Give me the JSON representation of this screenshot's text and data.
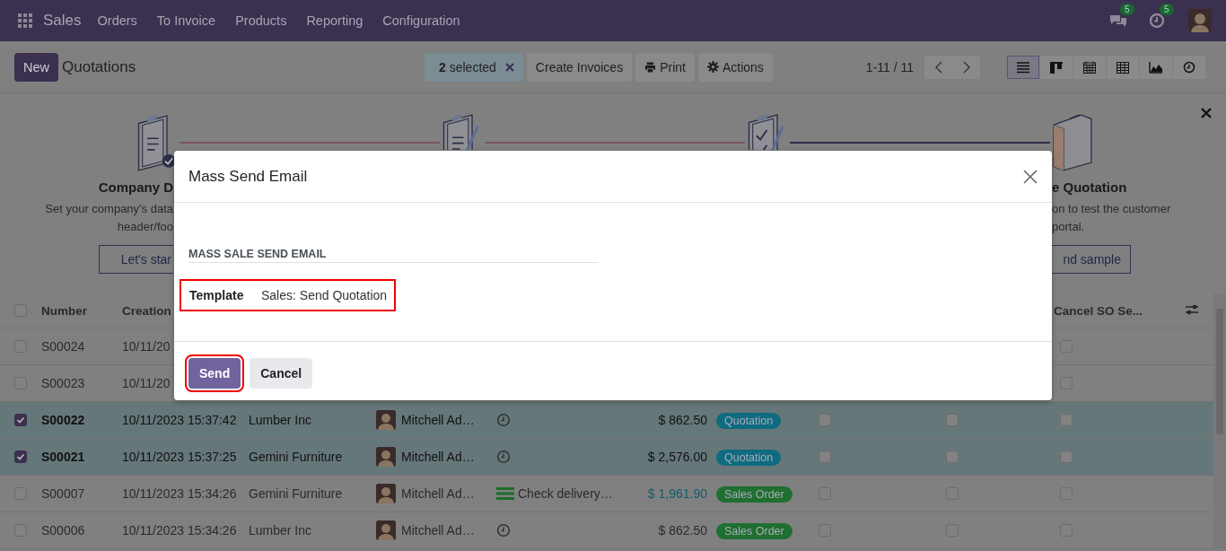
{
  "navbar": {
    "app": "Sales",
    "menu": [
      "Orders",
      "To Invoice",
      "Products",
      "Reporting",
      "Configuration"
    ],
    "messages_count": "5",
    "activities_count": "5"
  },
  "control_panel": {
    "new_button": "New",
    "title": "Quotations",
    "selection": "**2** selected",
    "actions": [
      {
        "kind": "plain",
        "label": "Create Invoices"
      },
      {
        "kind": "print",
        "label": "Print"
      },
      {
        "kind": "gear",
        "label": "Actions"
      }
    ],
    "pager": "1-11 / 11",
    "views": [
      {
        "kind": "list",
        "selected": true
      },
      {
        "kind": "kanban",
        "selected": false
      },
      {
        "kind": "calendar",
        "selected": false
      },
      {
        "kind": "pivot",
        "selected": false
      },
      {
        "kind": "graph",
        "selected": false
      },
      {
        "kind": "activity",
        "selected": false
      }
    ]
  },
  "onboarding": {
    "left": {
      "title": "Company D",
      "lines": [
        "Set your company's data",
        "header/foo"
      ],
      "button": "Let's star"
    },
    "right": {
      "title": "e Quotation",
      "lines": [
        "on to test the customer",
        "portal."
      ],
      "button": "nd sample"
    }
  },
  "table": {
    "select_all_checked": false,
    "columns": [
      "Number",
      "Creation",
      "Cancel SO Se..."
    ],
    "rows": [
      {
        "selected": false,
        "number": "S00024",
        "date": "10/11/20",
        "cancel_so_se": false
      },
      {
        "selected": false,
        "number": "S00023",
        "date": "10/11/20",
        "cancel_so_se": false
      },
      {
        "selected": true,
        "number": "S00022",
        "date": "10/11/2023 15:37:42",
        "customer": "Lumber Inc",
        "salesperson": "Mitchell Ad…",
        "activity": {
          "kind": "clock"
        },
        "total": "$ 862.50",
        "total_highlighted": false,
        "status": {
          "label": "Quotation",
          "color": "#0f6b7f"
        },
        "column_7": false,
        "column_8": false,
        "cancel_so_se": false
      },
      {
        "selected": true,
        "number": "S00021",
        "date": "10/11/2023 15:37:25",
        "customer": "Gemini Furniture",
        "salesperson": "Mitchell Ad…",
        "activity": {
          "kind": "clock"
        },
        "total": "$ 2,576.00",
        "total_highlighted": false,
        "status": {
          "label": "Quotation",
          "color": "#0f6b7f"
        },
        "column_7": false,
        "column_8": false,
        "cancel_so_se": false
      },
      {
        "selected": false,
        "number": "S00007",
        "date": "10/11/2023 15:34:26",
        "customer": "Gemini Furniture",
        "salesperson": "Mitchell Ad…",
        "activity": {
          "kind": "todo",
          "text": "Check delivery…"
        },
        "total": "$ 1,961.90",
        "total_highlighted": true,
        "status": {
          "label": "Sales Order",
          "color": "#1f6f30"
        },
        "column_7": false,
        "column_8": false,
        "cancel_so_se": false
      },
      {
        "selected": false,
        "number": "S00006",
        "date": "10/11/2023 15:34:26",
        "customer": "Lumber Inc",
        "salesperson": "Mitchell Ad…",
        "activity": {
          "kind": "clock"
        },
        "total": "$ 862.50",
        "total_highlighted": false,
        "status": {
          "label": "Sales Order",
          "color": "#1f6f30"
        },
        "column_7": false,
        "column_8": false,
        "cancel_so_se": false
      }
    ]
  },
  "dialog": {
    "title": "Mass Send Email",
    "section": "MASS SALE SEND EMAIL",
    "field": {
      "label": "Template",
      "value": "Sales: Send Quotation",
      "highlighted": true
    },
    "buttons": [
      {
        "kind": "primary",
        "label": "Send",
        "highlighted": true
      },
      {
        "kind": "secondary",
        "label": "Cancel",
        "highlighted": false
      }
    ]
  }
}
